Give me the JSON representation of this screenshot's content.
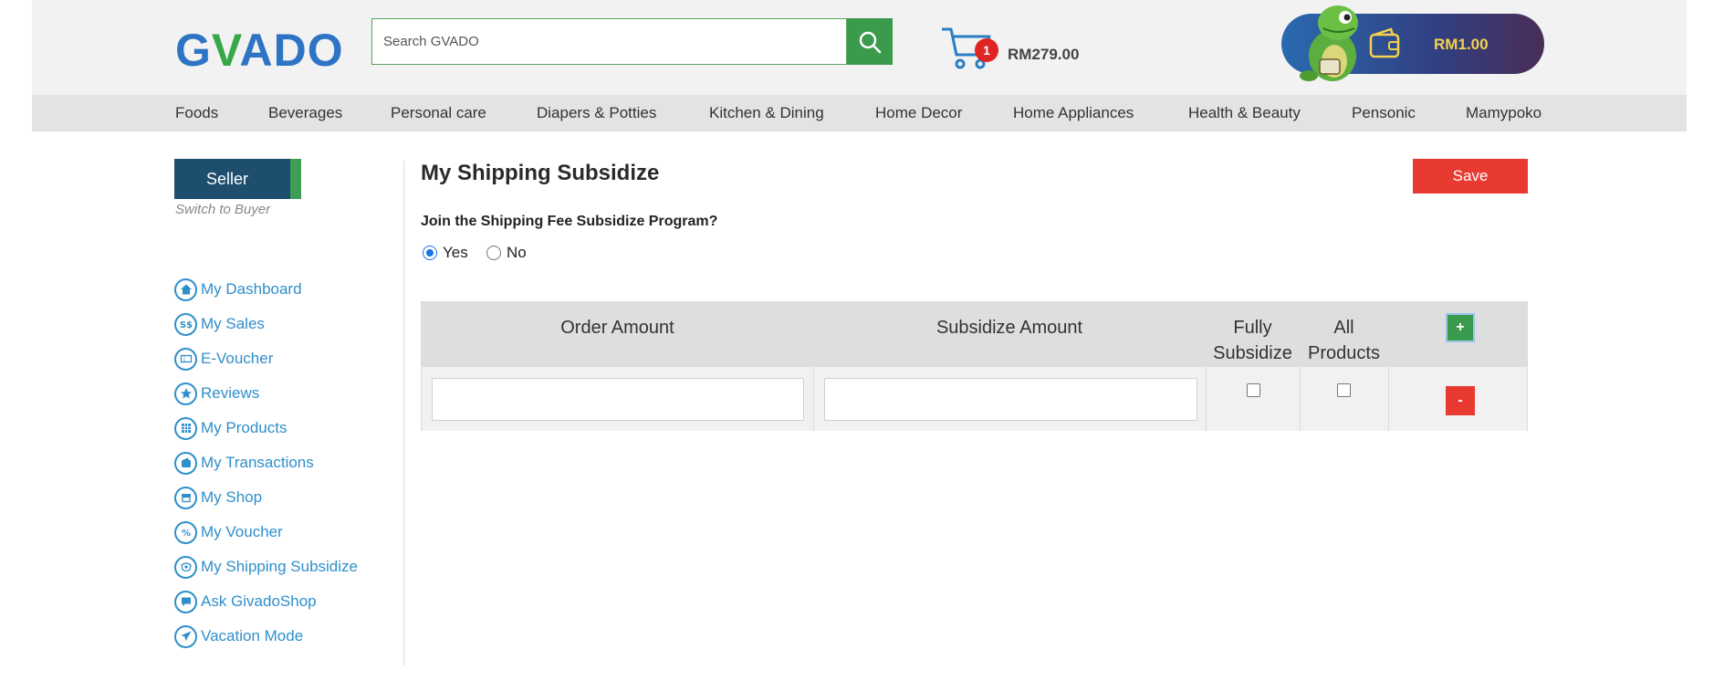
{
  "header": {
    "logo_text_g": "G",
    "logo_text_v": "V",
    "logo_text_rest": "ADO",
    "search_placeholder": "Search GVADO",
    "cart_count": "1",
    "cart_amount": "RM279.00",
    "wallet_amount": "RM1.00"
  },
  "nav": {
    "items": [
      "Foods",
      "Beverages",
      "Personal care",
      "Diapers & Potties",
      "Kitchen & Dining",
      "Home Decor",
      "Home Appliances",
      "Health & Beauty",
      "Pensonic",
      "Mamypoko"
    ]
  },
  "sidebar": {
    "seller_label": "Seller",
    "switch_label": "Switch to Buyer",
    "items": [
      {
        "label": "My Dashboard",
        "icon": "home-icon"
      },
      {
        "label": "My Sales",
        "icon": "dollar-icon"
      },
      {
        "label": "E-Voucher",
        "icon": "voucher-icon"
      },
      {
        "label": "Reviews",
        "icon": "star-icon"
      },
      {
        "label": "My Products",
        "icon": "grid-icon"
      },
      {
        "label": "My Transactions",
        "icon": "wallet-icon"
      },
      {
        "label": "My Shop",
        "icon": "shop-icon"
      },
      {
        "label": "My Voucher",
        "icon": "percent-icon"
      },
      {
        "label": "My Shipping Subsidize",
        "icon": "shipping-icon"
      },
      {
        "label": "Ask GivadoShop",
        "icon": "chat-icon"
      },
      {
        "label": "Vacation Mode",
        "icon": "plane-icon"
      }
    ]
  },
  "main": {
    "title": "My Shipping Subsidize",
    "save_label": "Save",
    "question": "Join the Shipping Fee Subsidize Program?",
    "option_yes": "Yes",
    "option_no": "No",
    "selected": "Yes",
    "table": {
      "col_order": "Order Amount",
      "col_subsidize": "Subsidize Amount",
      "col_fully_1": "Fully",
      "col_fully_2": "Subsidize",
      "col_all_1": "All",
      "col_all_2": "Products",
      "add_label": "+",
      "remove_label": "-",
      "rows": [
        {
          "order_amount": "",
          "subsidize_amount": "",
          "fully_subsidize": false,
          "all_products": false
        }
      ]
    }
  },
  "colors": {
    "accent_green": "#3b9b4c",
    "link_blue": "#2f8fca",
    "save_red": "#e83a30",
    "seller_navy": "#1d4e6e"
  }
}
